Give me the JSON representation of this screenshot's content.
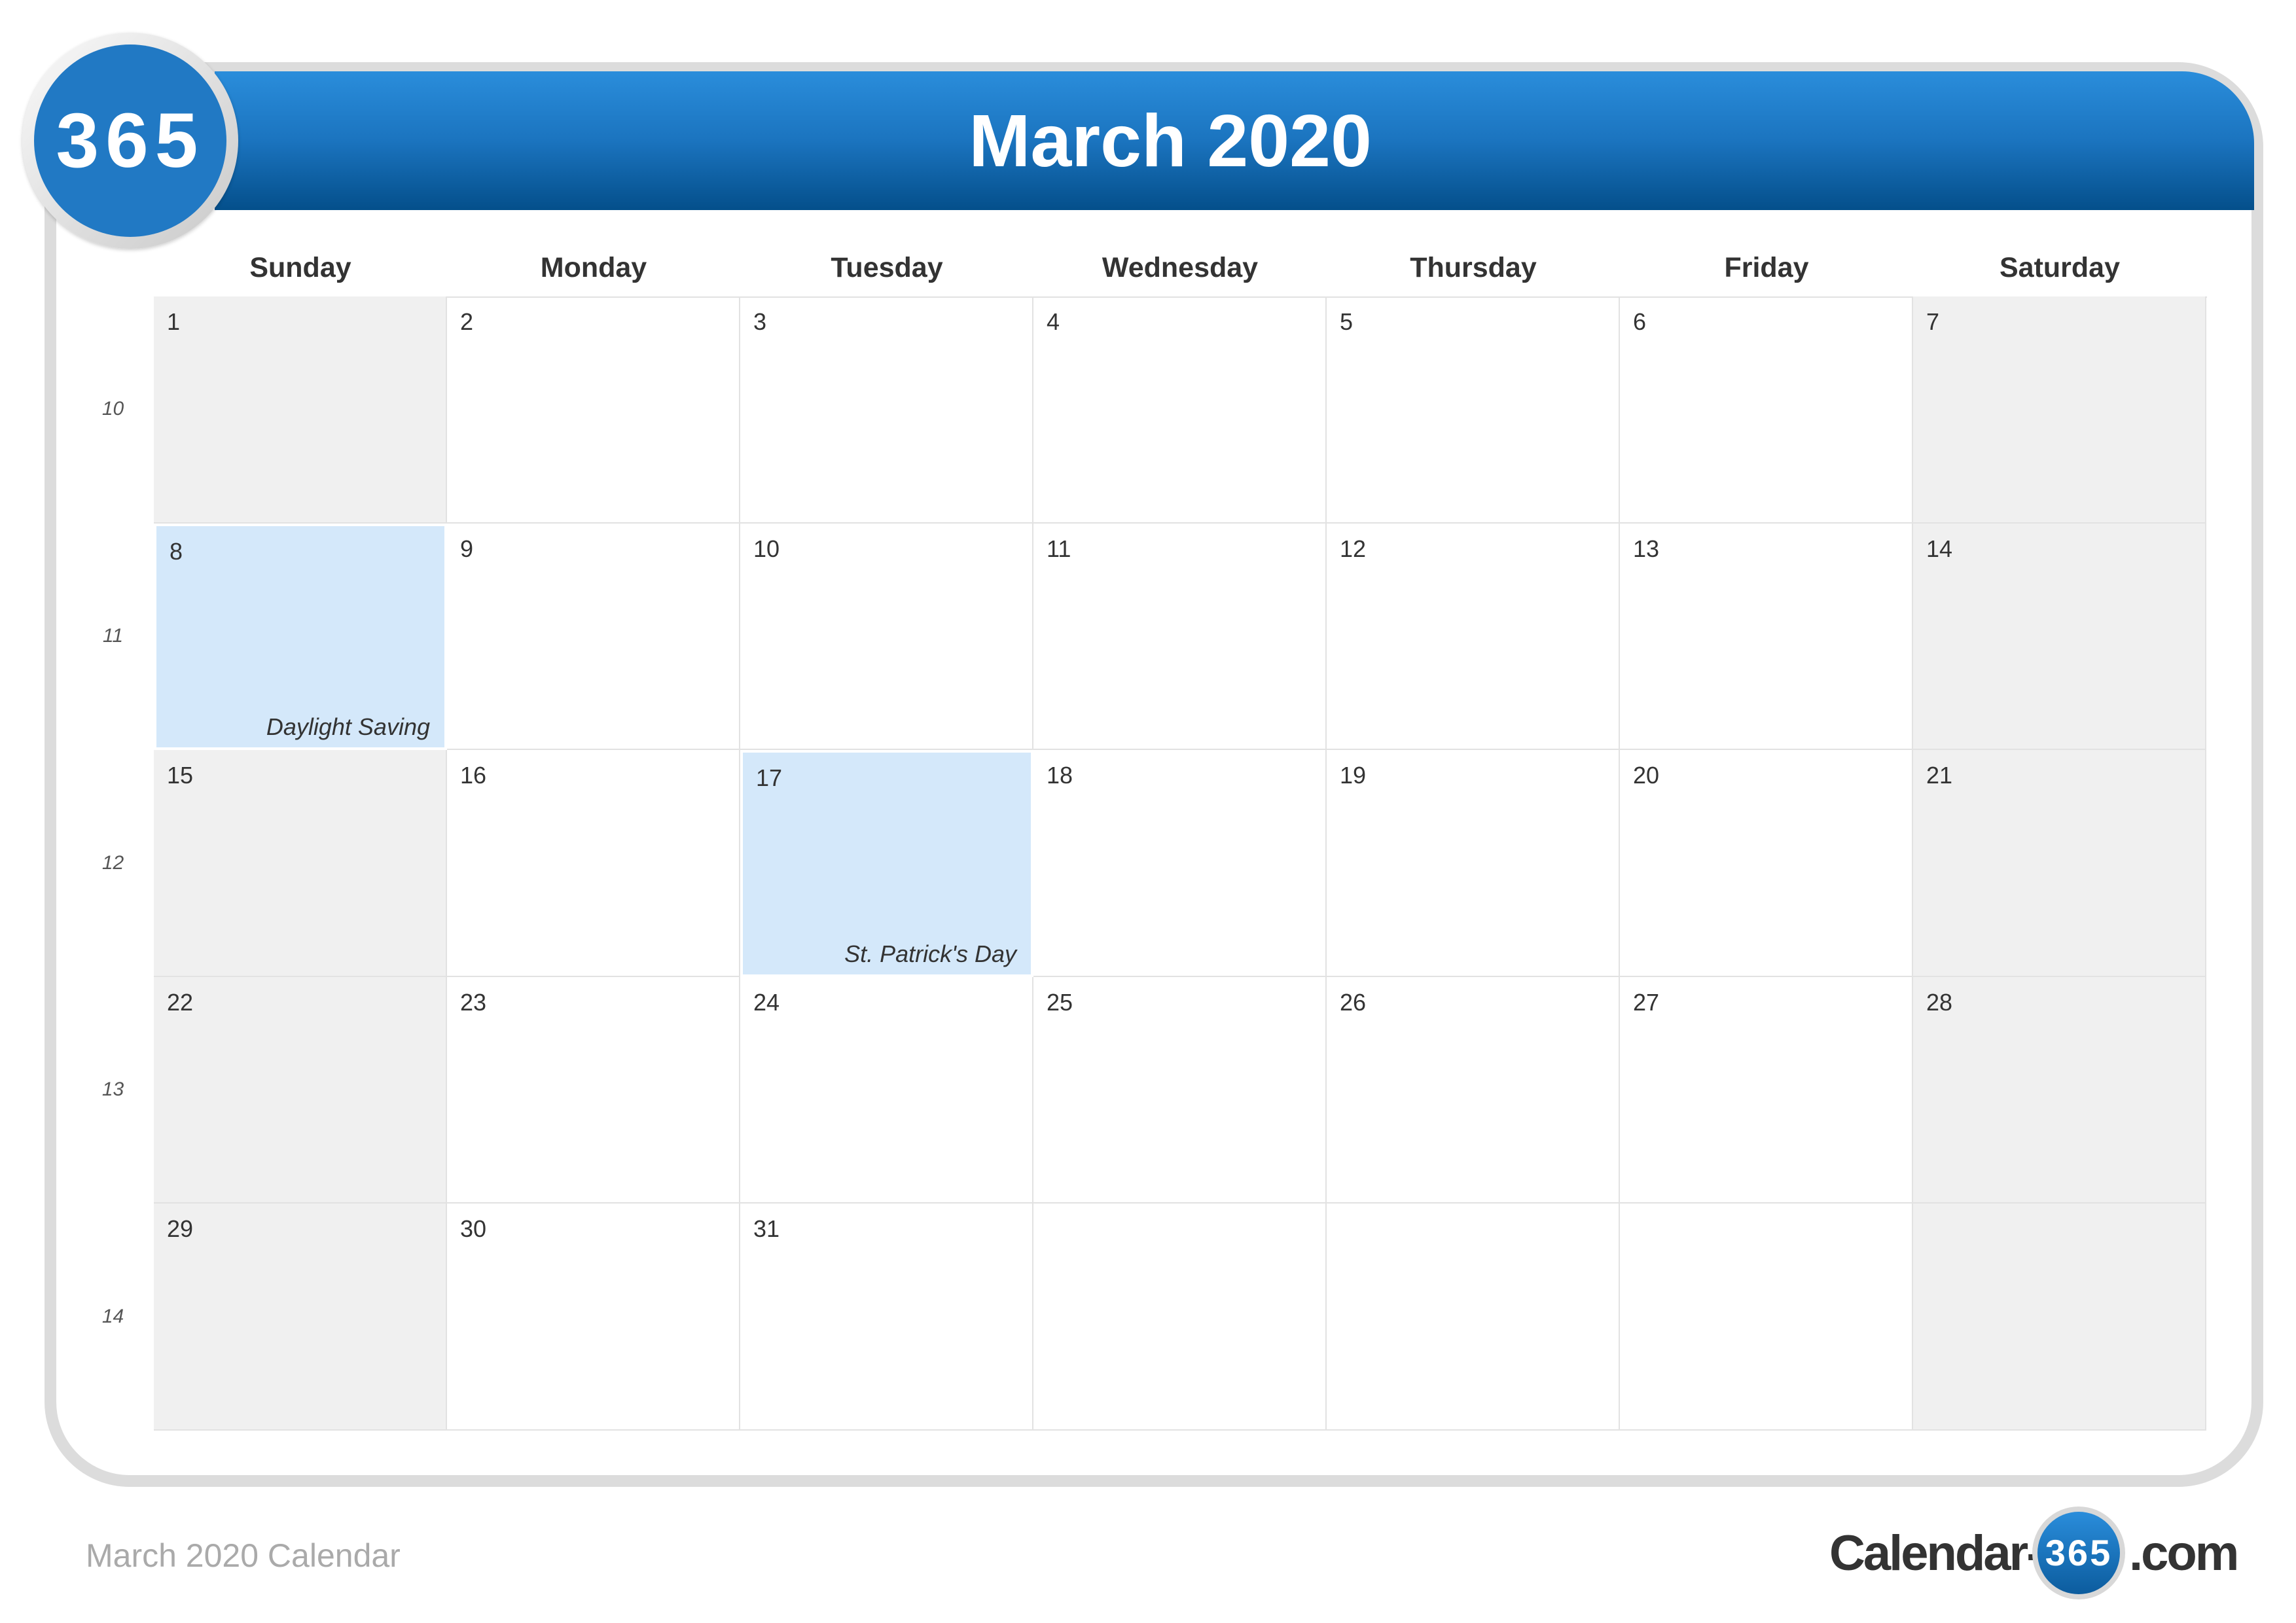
{
  "logo_text": "365",
  "title": "March 2020",
  "weekdays": [
    "Sunday",
    "Monday",
    "Tuesday",
    "Wednesday",
    "Thursday",
    "Friday",
    "Saturday"
  ],
  "week_numbers": [
    "10",
    "11",
    "12",
    "13",
    "14"
  ],
  "weeks": [
    [
      "1",
      "2",
      "3",
      "4",
      "5",
      "6",
      "7"
    ],
    [
      "8",
      "9",
      "10",
      "11",
      "12",
      "13",
      "14"
    ],
    [
      "15",
      "16",
      "17",
      "18",
      "19",
      "20",
      "21"
    ],
    [
      "22",
      "23",
      "24",
      "25",
      "26",
      "27",
      "28"
    ],
    [
      "29",
      "30",
      "31",
      "",
      "",
      "",
      ""
    ]
  ],
  "events": {
    "8": "Daylight Saving",
    "17": "St. Patrick's Day"
  },
  "footer": "March 2020 Calendar",
  "brand": {
    "left": "Calendar-",
    "circle": "365",
    "right": ".com"
  },
  "colors": {
    "header": "#1b74bf",
    "highlight": "#d4e8fa",
    "weekend": "#f0f0f0"
  }
}
